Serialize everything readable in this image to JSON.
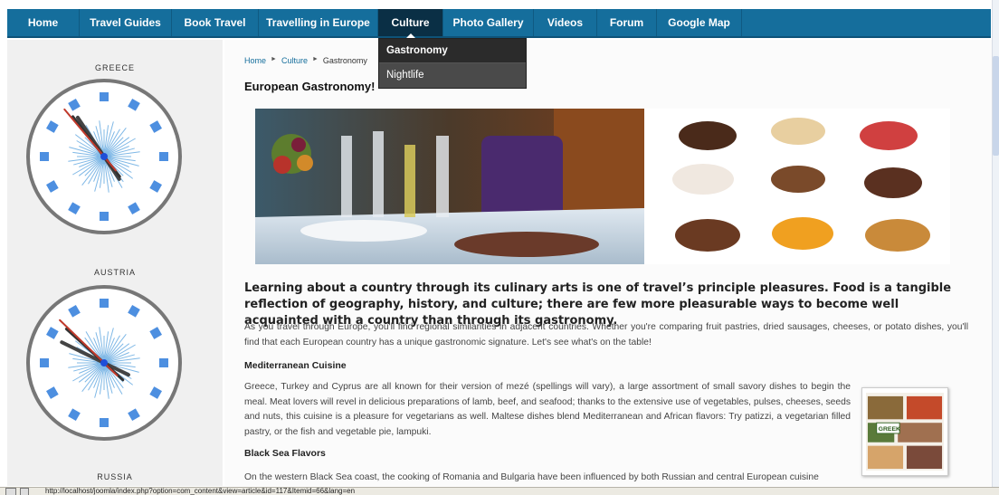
{
  "nav": {
    "items": [
      {
        "label": "Home",
        "width": 0
      },
      {
        "label": "Travel Guides"
      },
      {
        "label": "Book Travel"
      },
      {
        "label": "Travelling in Europe"
      },
      {
        "label": "Culture",
        "active": true
      },
      {
        "label": "Photo Gallery"
      },
      {
        "label": "Videos"
      },
      {
        "label": "Forum"
      },
      {
        "label": "Google Map"
      }
    ]
  },
  "dropdown": {
    "items": [
      "Gastronomy",
      "Nightlife"
    ]
  },
  "sidebar": {
    "clocks": [
      {
        "label": "GREECE"
      },
      {
        "label": "AUSTRIA"
      },
      {
        "label": "RUSSIA"
      }
    ]
  },
  "breadcrumb": {
    "home": "Home",
    "culture": "Culture",
    "current": "Gastronomy",
    "separator": "►"
  },
  "article": {
    "title": "European Gastronomy!",
    "lead": "Learning about a country through its culinary arts is one of travel’s principle pleasures. Food is a tangible reflection of geography, history, and culture; there are few more pleasurable ways to become well acquainted with a country than through its gastronomy.",
    "intro": "As you travel through Europe, you'll find regional similarities in adjacent countries. Whether you're comparing fruit pastries, dried sausages, cheeses, or potato dishes, you'll find that each European country has a unique gastronomic signature. Let's see what's on the table!",
    "section1_title": "Mediterranean Cuisine",
    "section1_text": "Greece, Turkey and Cyprus are all known for their version of mezé (spellings will vary), a large assortment of small savory dishes to begin the meal. Meat lovers will revel in delicious preparations of lamb, beef, and seafood; thanks to the extensive use of vegetables, pulses, cheeses, seeds and nuts, this cuisine is a pleasure for vegetarians as well. Maltese dishes blend Mediterranean and African flavors: Try patizzi, a vegetarian filled pastry, or the fish and vegetable pie, lampuki.",
    "section2_title": "Black Sea Flavors",
    "section2_text": "On the western Black Sea coast, the cooking of Romania and Bulgaria have been influenced by both Russian and central European cuisine",
    "thumb_caption": "GREEK"
  },
  "statusbar": {
    "url": "http://localhost/joomla/index.php?option=com_content&view=article&id=117&Itemid=66&lang=en"
  },
  "colors": {
    "nav_bg": "#156e9c",
    "nav_active": "#0a2f45",
    "clock_ring": "#777777",
    "clock_marks": "#4d8fe0",
    "clock_rays": "#7fb8e6",
    "second_hand": "#c0392b",
    "link": "#156e9c"
  }
}
